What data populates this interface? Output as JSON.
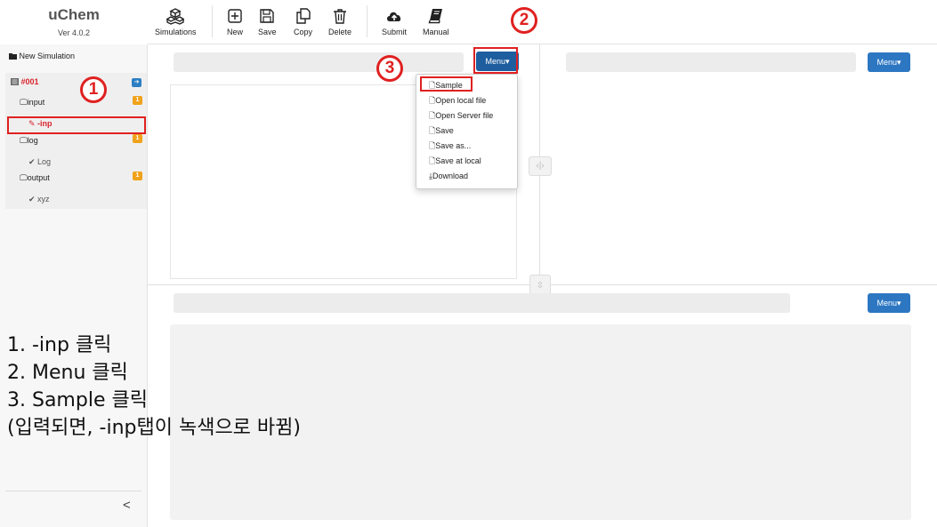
{
  "app": {
    "title": "uChem",
    "version": "Ver 4.0.2"
  },
  "toolbar": {
    "simulations": "Simulations",
    "new": "New",
    "save": "Save",
    "copy": "Copy",
    "delete": "Delete",
    "submit": "Submit",
    "manual": "Manual"
  },
  "sidebar": {
    "new_simulation": "New Simulation",
    "sim_id": "#001",
    "input": "input",
    "input_badge": "1",
    "inp": "-inp",
    "log": "log",
    "log_badge": "1",
    "log_item": "Log",
    "output": "output",
    "output_badge": "1",
    "xyz": "xyz",
    "collapse": "<"
  },
  "menus": {
    "top_left": "Menu",
    "top_right": "Menu",
    "bottom": "Menu"
  },
  "dropdown": [
    "Sample",
    "Open local file",
    "Open Server file",
    "Save",
    "Save as...",
    "Save at local",
    "Download"
  ],
  "annotations": {
    "n1": "1",
    "n2": "2",
    "n3": "3"
  },
  "instructions": {
    "line1": "1. -inp 클릭",
    "line2": "2. Menu 클릭",
    "line3": "3. Sample 클릭",
    "line4": "(입력되면, -inp탭이 녹색으로 바뀜)"
  },
  "colors": {
    "accent": "#2d77c2",
    "annotation": "#e02020",
    "badge": "#f0a21b",
    "active_item": "#d9252e"
  }
}
